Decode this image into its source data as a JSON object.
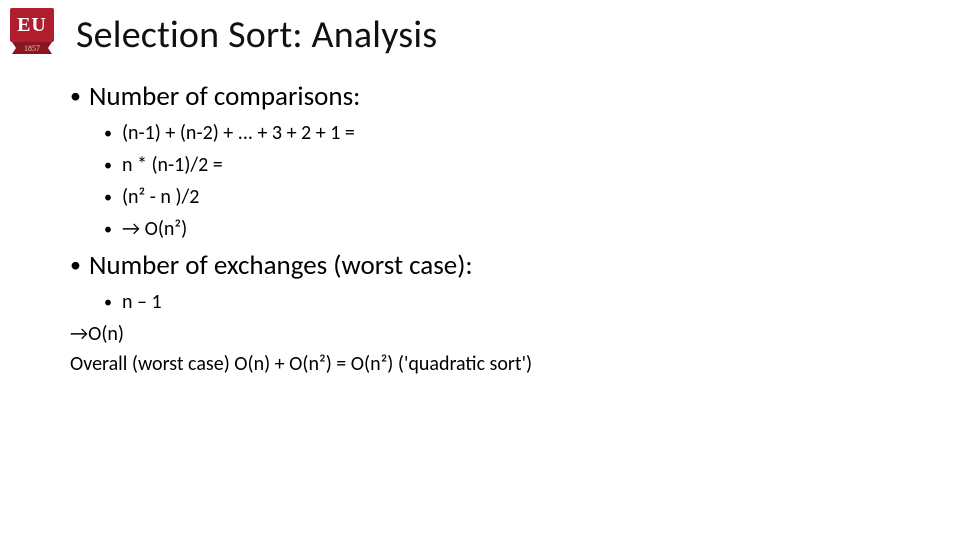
{
  "logo": {
    "text": "EU",
    "year": "1857"
  },
  "title": "Selection Sort: Analysis",
  "sections": {
    "comparisons": {
      "heading": "Number of comparisons:",
      "items": [
        "(n-1) + (n-2) + ... + 3 + 2 + 1 =",
        "n * (n-1)/2 =",
        "(n² - n )/2",
        "→ O(n²)"
      ]
    },
    "exchanges": {
      "heading": "Number of exchanges (worst case):",
      "items": [
        "n – 1"
      ],
      "conclusion1": "→O(n)",
      "conclusion2": "Overall (worst case)  O(n) + O(n²) = O(n²)   ('quadratic sort')"
    }
  }
}
